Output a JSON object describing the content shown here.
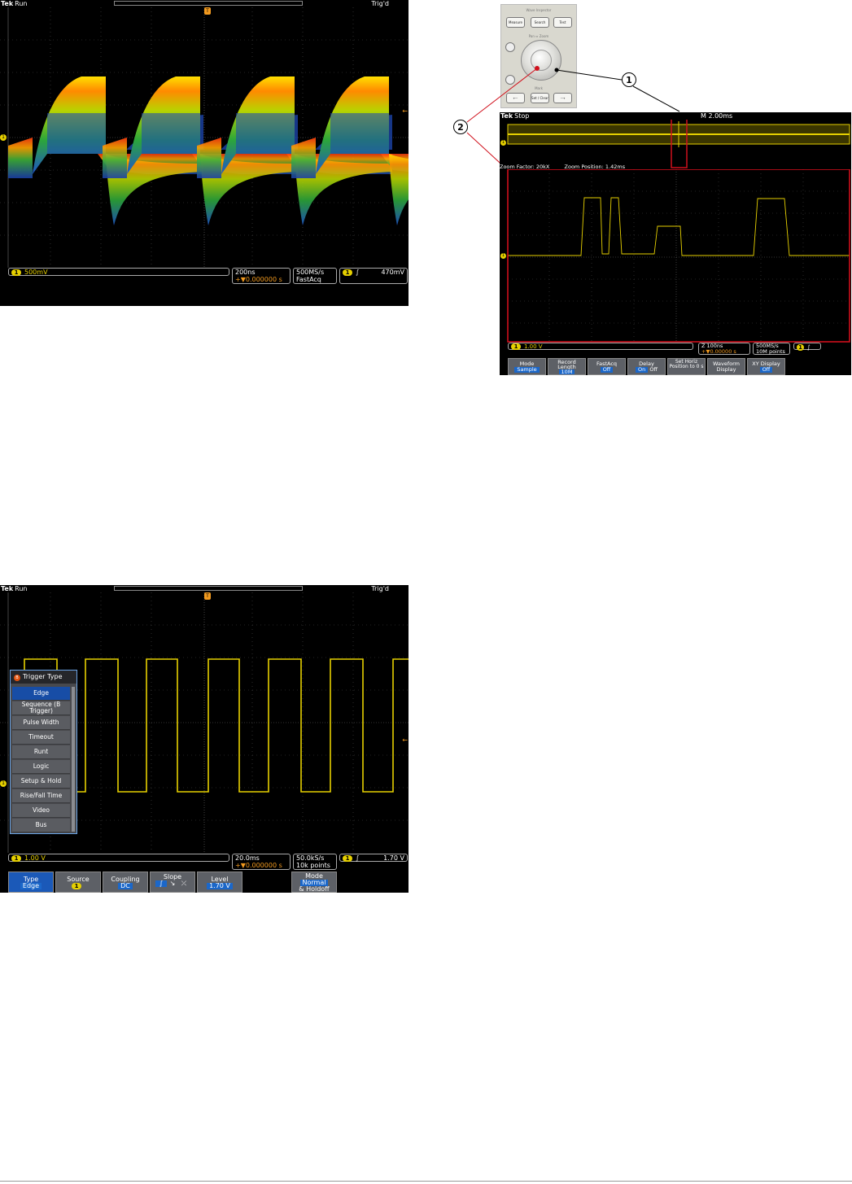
{
  "scope1": {
    "brand": "Tek",
    "state": "Run",
    "trig_status": "Trig'd",
    "ch1_scale": "500mV",
    "time_div": "200ns",
    "trigger_delay": "+▼0.000000 s",
    "sample_rate": "500MS/s",
    "acq_mode": "FastAcq",
    "trig_level": "470mV"
  },
  "scope2": {
    "brand": "Tek",
    "state": "Stop",
    "main_timebase": "M 2.00ms",
    "zoom_factor_label": "Zoom Factor:",
    "zoom_factor": "20kX",
    "zoom_position_label": "Zoom Position:",
    "zoom_position": "1.42ms",
    "ch1_scale": "1.00 V",
    "zoom_time_div": "Z 100ns",
    "trigger_delay": "+▼0.00000 s",
    "sample_rate": "500MS/s",
    "record_length": "10M points",
    "bottom_buttons": [
      {
        "label": "Mode",
        "value": "Sample"
      },
      {
        "label": "Record Length",
        "value": "10M"
      },
      {
        "label": "FastAcq",
        "value": "Off"
      },
      {
        "label": "Delay",
        "opt_on": "On",
        "opt_off": "Off"
      },
      {
        "label": "Set Horiz Position to 0 s",
        "value": ""
      },
      {
        "label": "Waveform Display",
        "value": ""
      },
      {
        "label": "XY Display",
        "value": "Off"
      }
    ],
    "panel_buttons": [
      "Measure",
      "Search",
      "Test",
      "Set / Clear"
    ],
    "panel_labels": [
      "Wave Inspector",
      "Pan ⇔ Zoom",
      "Mark"
    ],
    "callouts": [
      "1",
      "2"
    ]
  },
  "scope3": {
    "brand": "Tek",
    "state": "Run",
    "trig_status": "Trig'd",
    "ch1_scale": "1.00 V",
    "time_div": "20.0ms",
    "trigger_delay": "+▼0.000000 s",
    "sample_rate": "50.0kS/s",
    "record_length": "10k points",
    "trig_level": "1.70 V",
    "menu_title": "Trigger Type",
    "menu_items": [
      "Edge",
      "Sequence (B Trigger)",
      "Pulse Width",
      "Timeout",
      "Runt",
      "Logic",
      "Setup & Hold",
      "Rise/Fall Time",
      "Video",
      "Bus"
    ],
    "menu_selected": "Edge",
    "bottom_buttons": [
      {
        "label": "Type",
        "value": "Edge"
      },
      {
        "label": "Source",
        "value": "1"
      },
      {
        "label": "Coupling",
        "value": "DC"
      },
      {
        "label": "Slope",
        "value": ""
      },
      {
        "label": "Level",
        "value": "1.70 V"
      },
      {
        "label": "Mode",
        "value": "Normal",
        "extra": "& Holdoff"
      }
    ]
  },
  "colors": {
    "ch1": "#e6d000",
    "trigger_orange": "#f29a1f",
    "selected_blue": "#1b59b8",
    "callout_red": "#d0101c"
  }
}
